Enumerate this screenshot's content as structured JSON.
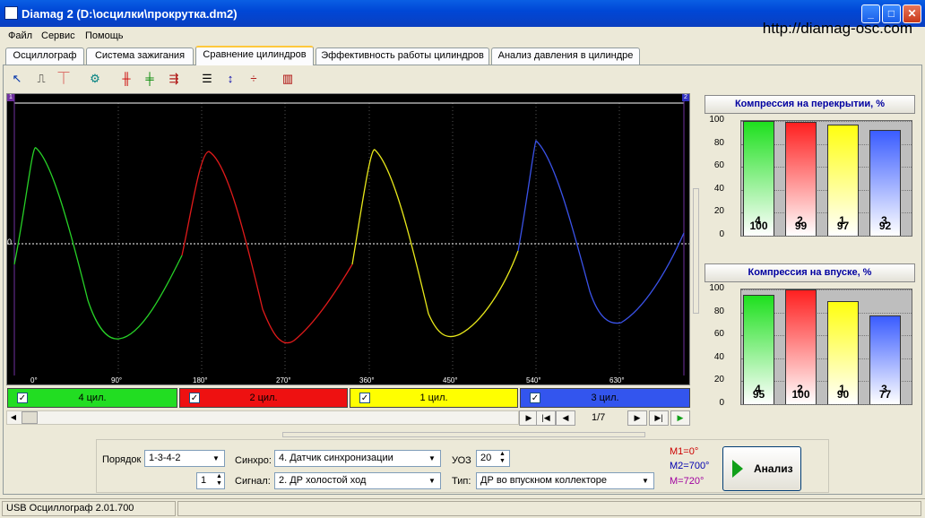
{
  "window": {
    "title": "Diamag 2 (D:\\осцилки\\прокрутка.dm2)"
  },
  "menu": [
    "Файл",
    "Сервис",
    "Помощь"
  ],
  "url": "http://diamag-osc.com",
  "tabs": [
    "Осциллограф",
    "Система зажигания",
    "Сравнение цилиндров",
    "Эффективность работы цилиндров",
    "Анализ давления в цилиндре"
  ],
  "active_tab": 2,
  "scope": {
    "zero_label": "0",
    "cursor_left": "1",
    "cursor_right": "2",
    "angle_labels": [
      "0°",
      "90°",
      "180°",
      "270°",
      "360°",
      "450°",
      "540°",
      "630°"
    ],
    "colors": {
      "cyl4": "#27d127",
      "cyl2": "#e01a1a",
      "cyl1": "#e8e81a",
      "cyl3": "#3a52e8"
    }
  },
  "legend": [
    {
      "label": "4 цил.",
      "color": "#22dd22"
    },
    {
      "label": "2 цил.",
      "color": "#ee1111"
    },
    {
      "label": "1 цил.",
      "color": "#ffff00"
    },
    {
      "label": "3 цил.",
      "color": "#3355ee"
    }
  ],
  "nav": {
    "page": "1/7"
  },
  "chart_data": [
    {
      "type": "bar",
      "title": "Компрессия на перекрытии, %",
      "categories": [
        "4",
        "2",
        "1",
        "3"
      ],
      "values": [
        100,
        99,
        97,
        92
      ],
      "colors": [
        "#1ee01e",
        "#ff2020",
        "#ffff10",
        "#3a5cff"
      ],
      "ylim": [
        0,
        100
      ],
      "yticks": [
        "0",
        "20",
        "40",
        "60",
        "80",
        "100"
      ]
    },
    {
      "type": "bar",
      "title": "Компрессия на впуске, %",
      "categories": [
        "4",
        "2",
        "1",
        "3"
      ],
      "values": [
        95,
        100,
        90,
        77
      ],
      "colors": [
        "#1ee01e",
        "#ff2020",
        "#ffff10",
        "#3a5cff"
      ],
      "ylim": [
        0,
        100
      ],
      "yticks": [
        "0",
        "20",
        "40",
        "60",
        "80",
        "100"
      ]
    }
  ],
  "controls": {
    "order_label": "Порядок",
    "order_value": "1-3-4-2",
    "order_sub": "1",
    "sync_label": "Синхро:",
    "sync_value": "4.  Датчик синхронизации",
    "signal_label": "Сигнал:",
    "signal_value": "2.  ДР холостой ход",
    "uoz_label": "УОЗ",
    "uoz_value": "20",
    "type_label": "Тип:",
    "type_value": "ДР во впускном коллекторе",
    "m1": "M1=0°",
    "m2": "M2=700°",
    "m3": "M=720°",
    "analyze": "Анализ"
  },
  "status": {
    "left": "USB Осциллограф  2.01.700"
  }
}
